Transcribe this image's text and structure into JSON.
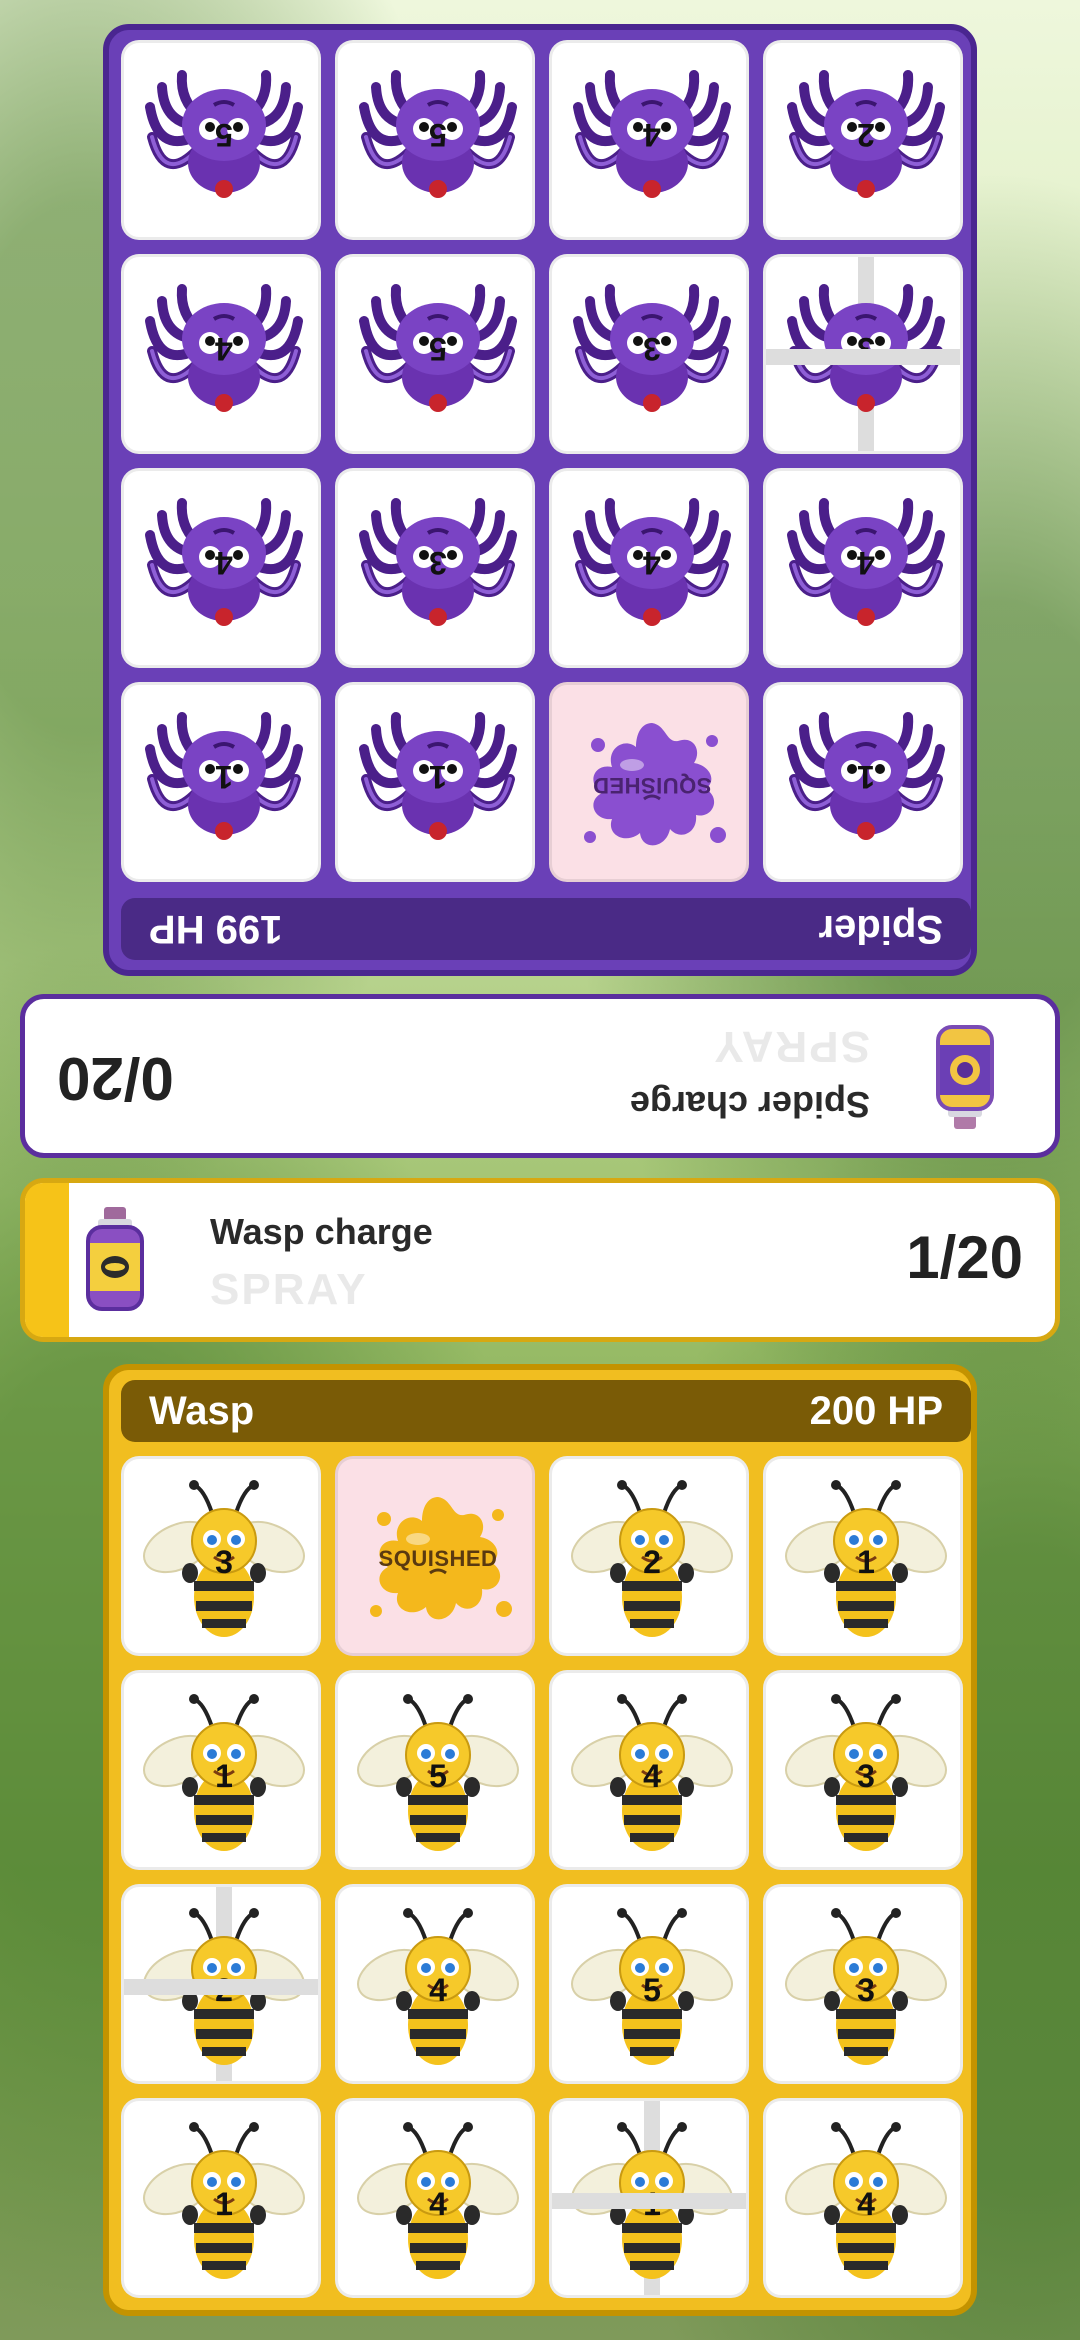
{
  "spider": {
    "name": "Spider",
    "hp": "199 HP",
    "color": "#6a40b7",
    "card": {
      "title": "Spider charge",
      "spray_label": "SPRAY",
      "count": "0/20"
    },
    "cells": [
      {
        "n": "5"
      },
      {
        "n": "5"
      },
      {
        "n": "4"
      },
      {
        "n": "2"
      },
      {
        "n": "4"
      },
      {
        "n": "5"
      },
      {
        "n": "3"
      },
      {
        "n": "3",
        "cross": true
      },
      {
        "n": "4"
      },
      {
        "n": "3"
      },
      {
        "n": "4"
      },
      {
        "n": "4"
      },
      {
        "n": "1"
      },
      {
        "n": "1"
      },
      {
        "squished": true,
        "label": "SQUISHED"
      },
      {
        "n": "1"
      }
    ]
  },
  "wasp": {
    "name": "Wasp",
    "hp": "200 HP",
    "color": "#f1be20",
    "card": {
      "title": "Wasp charge",
      "spray_label": "SPRAY",
      "count": "1/20"
    },
    "cells": [
      {
        "n": "3"
      },
      {
        "squished": true,
        "label": "SQUISHED"
      },
      {
        "n": "2"
      },
      {
        "n": "1"
      },
      {
        "n": "1"
      },
      {
        "n": "5"
      },
      {
        "n": "4"
      },
      {
        "n": "3"
      },
      {
        "n": "2",
        "cross": true
      },
      {
        "n": "4"
      },
      {
        "n": "5"
      },
      {
        "n": "3"
      },
      {
        "n": "1"
      },
      {
        "n": "4"
      },
      {
        "n": "1",
        "cross": true
      },
      {
        "n": "4"
      }
    ]
  }
}
